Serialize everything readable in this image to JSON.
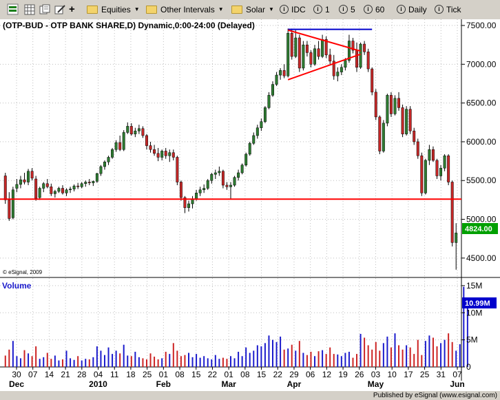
{
  "toolbar": {
    "equities_label": "Equities",
    "intervals_label": "Other Intervals",
    "solar_label": "Solar",
    "idc_label": "IDC",
    "n1_label": "1",
    "n5_label": "5",
    "n60_label": "60",
    "daily_label": "Daily",
    "tick_label": "Tick",
    "dropdown_glyph": "▼",
    "plus_glyph": "+",
    "info_glyph": "i"
  },
  "chart": {
    "title": "(OTP-BUD - OTP BANK SHARE,D) Dynamic,0:00-24:00 (Delayed)",
    "copyright": "© eSignal, 2009",
    "price_badge": "4824.00",
    "volume_label": "Volume",
    "volume_badge": "10.99M",
    "footer": "Published by eSignal (www.esignal.com)"
  },
  "colors": {
    "up": "#2e7d32",
    "down": "#c62828",
    "support_line": "#ff0000",
    "resistance_line": "#0000cc",
    "badge_green": "#00a000",
    "badge_blue": "#0000cc",
    "volume_blue": "#1a1acc",
    "volume_red": "#cc2222"
  },
  "chart_data": {
    "type": "candlestick",
    "y_ticks": [
      "7500.00",
      "7000.00",
      "6500.00",
      "6000.00",
      "5500.00",
      "5000.00",
      "4500.00"
    ],
    "y_range": [
      4250,
      7580
    ],
    "volume_ticks": [
      "15M",
      "10M",
      "5M",
      "0"
    ],
    "volume_range": [
      0,
      16
    ],
    "x_day_labels": [
      "30",
      "07",
      "14",
      "21",
      "28",
      "04",
      "11",
      "18",
      "25",
      "01",
      "08",
      "15",
      "22",
      "01",
      "08",
      "15",
      "22",
      "29",
      "06",
      "12",
      "19",
      "26",
      "03",
      "10",
      "17",
      "25",
      "31",
      "07"
    ],
    "x_month_labels": [
      "Dec",
      "2010",
      "Feb",
      "Mar",
      "Apr",
      "May",
      "Jun"
    ],
    "horizontal_line_price": 5260,
    "top_line_price": 7450,
    "candles": [
      {
        "o": 5560,
        "h": 5600,
        "l": 5200,
        "c": 5250
      },
      {
        "o": 5250,
        "h": 5350,
        "l": 4980,
        "c": 5010
      },
      {
        "o": 5020,
        "h": 5420,
        "l": 5000,
        "c": 5380
      },
      {
        "o": 5400,
        "h": 5520,
        "l": 5350,
        "c": 5450
      },
      {
        "o": 5450,
        "h": 5560,
        "l": 5400,
        "c": 5510
      },
      {
        "o": 5510,
        "h": 5600,
        "l": 5450,
        "c": 5480
      },
      {
        "o": 5480,
        "h": 5650,
        "l": 5440,
        "c": 5620
      },
      {
        "o": 5620,
        "h": 5660,
        "l": 5500,
        "c": 5530
      },
      {
        "o": 5520,
        "h": 5560,
        "l": 5240,
        "c": 5270
      },
      {
        "o": 5280,
        "h": 5420,
        "l": 5250,
        "c": 5400
      },
      {
        "o": 5400,
        "h": 5480,
        "l": 5350,
        "c": 5460
      },
      {
        "o": 5460,
        "h": 5520,
        "l": 5400,
        "c": 5420
      },
      {
        "o": 5420,
        "h": 5460,
        "l": 5300,
        "c": 5330
      },
      {
        "o": 5330,
        "h": 5380,
        "l": 5280,
        "c": 5360
      },
      {
        "o": 5360,
        "h": 5420,
        "l": 5340,
        "c": 5400
      },
      {
        "o": 5400,
        "h": 5440,
        "l": 5320,
        "c": 5340
      },
      {
        "o": 5340,
        "h": 5400,
        "l": 5300,
        "c": 5380
      },
      {
        "o": 5380,
        "h": 5420,
        "l": 5340,
        "c": 5390
      },
      {
        "o": 5390,
        "h": 5450,
        "l": 5360,
        "c": 5430
      },
      {
        "o": 5430,
        "h": 5470,
        "l": 5390,
        "c": 5420
      },
      {
        "o": 5420,
        "h": 5480,
        "l": 5400,
        "c": 5460
      },
      {
        "o": 5460,
        "h": 5500,
        "l": 5420,
        "c": 5480
      },
      {
        "o": 5480,
        "h": 5520,
        "l": 5440,
        "c": 5470
      },
      {
        "o": 5470,
        "h": 5500,
        "l": 5430,
        "c": 5490
      },
      {
        "o": 5490,
        "h": 5600,
        "l": 5470,
        "c": 5590
      },
      {
        "o": 5590,
        "h": 5700,
        "l": 5560,
        "c": 5680
      },
      {
        "o": 5680,
        "h": 5760,
        "l": 5640,
        "c": 5740
      },
      {
        "o": 5740,
        "h": 5820,
        "l": 5700,
        "c": 5800
      },
      {
        "o": 5800,
        "h": 5920,
        "l": 5780,
        "c": 5900
      },
      {
        "o": 5900,
        "h": 6020,
        "l": 5870,
        "c": 5990
      },
      {
        "o": 5990,
        "h": 6080,
        "l": 5880,
        "c": 5900
      },
      {
        "o": 5900,
        "h": 6150,
        "l": 5880,
        "c": 6120
      },
      {
        "o": 6120,
        "h": 6250,
        "l": 6100,
        "c": 6200
      },
      {
        "o": 6200,
        "h": 6240,
        "l": 6080,
        "c": 6100
      },
      {
        "o": 6100,
        "h": 6180,
        "l": 6060,
        "c": 6140
      },
      {
        "o": 6140,
        "h": 6220,
        "l": 6100,
        "c": 6170
      },
      {
        "o": 6170,
        "h": 6200,
        "l": 6050,
        "c": 6080
      },
      {
        "o": 6080,
        "h": 6100,
        "l": 5900,
        "c": 5950
      },
      {
        "o": 5950,
        "h": 6000,
        "l": 5860,
        "c": 5900
      },
      {
        "o": 5900,
        "h": 5960,
        "l": 5820,
        "c": 5850
      },
      {
        "o": 5850,
        "h": 5920,
        "l": 5750,
        "c": 5800
      },
      {
        "o": 5800,
        "h": 5900,
        "l": 5760,
        "c": 5880
      },
      {
        "o": 5880,
        "h": 5920,
        "l": 5780,
        "c": 5820
      },
      {
        "o": 5820,
        "h": 5900,
        "l": 5740,
        "c": 5860
      },
      {
        "o": 5860,
        "h": 5900,
        "l": 5760,
        "c": 5800
      },
      {
        "o": 5800,
        "h": 5820,
        "l": 5440,
        "c": 5480
      },
      {
        "o": 5480,
        "h": 5500,
        "l": 5240,
        "c": 5280
      },
      {
        "o": 5280,
        "h": 5300,
        "l": 5080,
        "c": 5150
      },
      {
        "o": 5150,
        "h": 5240,
        "l": 5100,
        "c": 5200
      },
      {
        "o": 5200,
        "h": 5300,
        "l": 5140,
        "c": 5260
      },
      {
        "o": 5260,
        "h": 5380,
        "l": 5240,
        "c": 5340
      },
      {
        "o": 5340,
        "h": 5420,
        "l": 5300,
        "c": 5380
      },
      {
        "o": 5380,
        "h": 5450,
        "l": 5340,
        "c": 5400
      },
      {
        "o": 5400,
        "h": 5520,
        "l": 5380,
        "c": 5500
      },
      {
        "o": 5500,
        "h": 5600,
        "l": 5460,
        "c": 5580
      },
      {
        "o": 5580,
        "h": 5640,
        "l": 5520,
        "c": 5600
      },
      {
        "o": 5600,
        "h": 5680,
        "l": 5560,
        "c": 5620
      },
      {
        "o": 5620,
        "h": 5640,
        "l": 5400,
        "c": 5440
      },
      {
        "o": 5440,
        "h": 5480,
        "l": 5380,
        "c": 5420
      },
      {
        "o": 5420,
        "h": 5480,
        "l": 5260,
        "c": 5440
      },
      {
        "o": 5440,
        "h": 5560,
        "l": 5420,
        "c": 5540
      },
      {
        "o": 5540,
        "h": 5640,
        "l": 5500,
        "c": 5600
      },
      {
        "o": 5600,
        "h": 5720,
        "l": 5580,
        "c": 5700
      },
      {
        "o": 5700,
        "h": 5860,
        "l": 5680,
        "c": 5840
      },
      {
        "o": 5840,
        "h": 6000,
        "l": 5820,
        "c": 5980
      },
      {
        "o": 5980,
        "h": 6120,
        "l": 5960,
        "c": 6080
      },
      {
        "o": 6080,
        "h": 6220,
        "l": 6040,
        "c": 6180
      },
      {
        "o": 6180,
        "h": 6300,
        "l": 6140,
        "c": 6260
      },
      {
        "o": 6260,
        "h": 6460,
        "l": 6240,
        "c": 6440
      },
      {
        "o": 6440,
        "h": 6640,
        "l": 6420,
        "c": 6600
      },
      {
        "o": 6600,
        "h": 6780,
        "l": 6580,
        "c": 6740
      },
      {
        "o": 6740,
        "h": 6900,
        "l": 6720,
        "c": 6860
      },
      {
        "o": 6860,
        "h": 6950,
        "l": 6800,
        "c": 6920
      },
      {
        "o": 6920,
        "h": 7000,
        "l": 6820,
        "c": 6850
      },
      {
        "o": 6850,
        "h": 7460,
        "l": 6830,
        "c": 7400
      },
      {
        "o": 7400,
        "h": 7460,
        "l": 7060,
        "c": 7100
      },
      {
        "o": 7100,
        "h": 7440,
        "l": 7080,
        "c": 7340
      },
      {
        "o": 7340,
        "h": 7380,
        "l": 6900,
        "c": 6950
      },
      {
        "o": 6950,
        "h": 7300,
        "l": 6920,
        "c": 7250
      },
      {
        "o": 7250,
        "h": 7300,
        "l": 7100,
        "c": 7150
      },
      {
        "o": 7150,
        "h": 7180,
        "l": 6960,
        "c": 7000
      },
      {
        "o": 7000,
        "h": 7250,
        "l": 6980,
        "c": 7200
      },
      {
        "o": 7200,
        "h": 7300,
        "l": 7060,
        "c": 7100
      },
      {
        "o": 7100,
        "h": 7380,
        "l": 7080,
        "c": 7320
      },
      {
        "o": 7320,
        "h": 7360,
        "l": 7080,
        "c": 7120
      },
      {
        "o": 7120,
        "h": 7200,
        "l": 7000,
        "c": 7040
      },
      {
        "o": 7040,
        "h": 7120,
        "l": 6800,
        "c": 6850
      },
      {
        "o": 6850,
        "h": 6960,
        "l": 6780,
        "c": 6900
      },
      {
        "o": 6900,
        "h": 7000,
        "l": 6860,
        "c": 6960
      },
      {
        "o": 6960,
        "h": 7080,
        "l": 6920,
        "c": 7050
      },
      {
        "o": 7050,
        "h": 7380,
        "l": 7020,
        "c": 7300
      },
      {
        "o": 7300,
        "h": 7340,
        "l": 7140,
        "c": 7180
      },
      {
        "o": 7180,
        "h": 7280,
        "l": 6900,
        "c": 6960
      },
      {
        "o": 6960,
        "h": 7280,
        "l": 6940,
        "c": 7260
      },
      {
        "o": 7260,
        "h": 7300,
        "l": 7120,
        "c": 7160
      },
      {
        "o": 7160,
        "h": 7200,
        "l": 6900,
        "c": 6940
      },
      {
        "o": 6940,
        "h": 6960,
        "l": 6600,
        "c": 6640
      },
      {
        "o": 6640,
        "h": 6680,
        "l": 6280,
        "c": 6320
      },
      {
        "o": 6320,
        "h": 6340,
        "l": 5840,
        "c": 5880
      },
      {
        "o": 5880,
        "h": 6280,
        "l": 5860,
        "c": 6240
      },
      {
        "o": 6240,
        "h": 6620,
        "l": 6200,
        "c": 6600
      },
      {
        "o": 6600,
        "h": 6640,
        "l": 6320,
        "c": 6360
      },
      {
        "o": 6360,
        "h": 6600,
        "l": 6340,
        "c": 6560
      },
      {
        "o": 6560,
        "h": 6640,
        "l": 6400,
        "c": 6440
      },
      {
        "o": 6440,
        "h": 6480,
        "l": 6060,
        "c": 6100
      },
      {
        "o": 6100,
        "h": 6460,
        "l": 6080,
        "c": 6420
      },
      {
        "o": 6420,
        "h": 6460,
        "l": 6100,
        "c": 6140
      },
      {
        "o": 6140,
        "h": 6180,
        "l": 5960,
        "c": 6000
      },
      {
        "o": 6000,
        "h": 6040,
        "l": 5780,
        "c": 5820
      },
      {
        "o": 5820,
        "h": 5860,
        "l": 5300,
        "c": 5340
      },
      {
        "o": 5340,
        "h": 5780,
        "l": 5320,
        "c": 5760
      },
      {
        "o": 5760,
        "h": 5960,
        "l": 5700,
        "c": 5900
      },
      {
        "o": 5900,
        "h": 5940,
        "l": 5740,
        "c": 5760
      },
      {
        "o": 5760,
        "h": 5780,
        "l": 5520,
        "c": 5560
      },
      {
        "o": 5560,
        "h": 5700,
        "l": 5500,
        "c": 5660
      },
      {
        "o": 5660,
        "h": 5840,
        "l": 5620,
        "c": 5820
      },
      {
        "o": 5820,
        "h": 5840,
        "l": 5440,
        "c": 5480
      },
      {
        "o": 5480,
        "h": 5500,
        "l": 4650,
        "c": 4700
      },
      {
        "o": 4700,
        "h": 4950,
        "l": 4350,
        "c": 4824
      }
    ],
    "volumes_m": [
      2.1,
      3.2,
      4.8,
      2.0,
      1.6,
      3.1,
      2.5,
      2.0,
      3.8,
      1.5,
      1.8,
      2.6,
      1.5,
      2.1,
      1.2,
      1.4,
      3.0,
      1.6,
      1.3,
      2.0,
      1.2,
      1.5,
      1.4,
      1.8,
      3.8,
      3.0,
      2.2,
      3.6,
      2.4,
      3.0,
      2.5,
      4.1,
      2.1,
      2.0,
      2.8,
      1.8,
      1.6,
      1.4,
      2.5,
      1.9,
      1.4,
      1.6,
      2.8,
      2.4,
      4.4,
      3.0,
      2.0,
      2.2,
      2.6,
      1.8,
      2.4,
      1.7,
      2.0,
      1.6,
      1.4,
      2.2,
      1.5,
      1.7,
      1.5,
      2.0,
      1.6,
      2.8,
      2.0,
      3.6,
      2.6,
      3.0,
      4.0,
      3.8,
      4.4,
      5.8,
      5.0,
      4.6,
      5.6,
      3.2,
      3.4,
      4.1,
      3.0,
      4.8,
      2.6,
      2.2,
      2.8,
      2.0,
      2.9,
      3.1,
      2.4,
      3.6,
      2.4,
      2.3,
      2.0,
      2.6,
      2.8,
      1.7,
      2.4,
      6.1,
      5.4,
      4.0,
      3.2,
      4.6,
      3.0,
      4.4,
      5.6,
      3.6,
      6.2,
      4.0,
      3.2,
      4.0,
      3.6,
      2.4,
      5.0,
      2.2,
      4.8,
      5.8,
      5.4,
      3.8,
      4.4,
      5.0,
      6.2,
      4.6,
      3.0,
      4.2,
      14.8,
      11.0
    ]
  }
}
